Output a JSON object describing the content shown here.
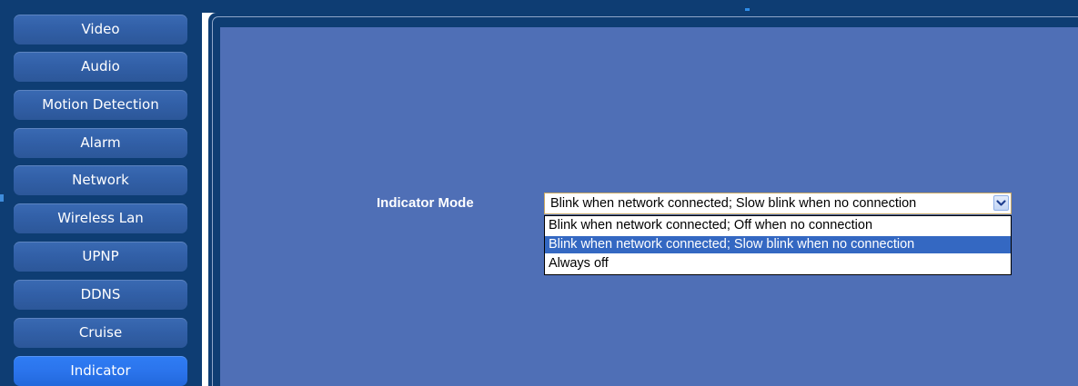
{
  "sidebar": {
    "items": [
      {
        "label": "Video"
      },
      {
        "label": "Audio"
      },
      {
        "label": "Motion Detection"
      },
      {
        "label": "Alarm"
      },
      {
        "label": "Network"
      },
      {
        "label": "Wireless Lan"
      },
      {
        "label": "UPNP"
      },
      {
        "label": "DDNS"
      },
      {
        "label": "Cruise"
      },
      {
        "label": "Indicator",
        "active": true
      }
    ]
  },
  "indicator": {
    "label": "Indicator Mode",
    "selected_value": "Blink when network connected; Slow blink when no connection",
    "dropdown_open": true,
    "options": [
      {
        "label": "Blink when network connected; Off when no connection"
      },
      {
        "label": "Blink when network connected; Slow blink when no connection",
        "highlighted": true
      },
      {
        "label": "Always off"
      }
    ]
  },
  "colors": {
    "frame_navy": "#0e3d73",
    "content_blue": "#4f6fb6",
    "nav_button": "#3260a8",
    "nav_active": "#2b74ec",
    "option_highlight": "#3468c2"
  },
  "icons": {
    "select_arrow": "chevron-down-icon"
  }
}
